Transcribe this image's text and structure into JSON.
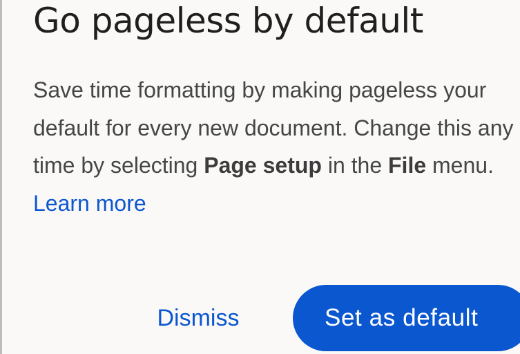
{
  "dialog": {
    "title": "Go pageless by default",
    "body": {
      "text_1": "Save time formatting by making pageless your default for every new document. Change this any time by selecting ",
      "bold_1": "Page setup",
      "text_2": " in the ",
      "bold_2": "File",
      "text_3": " menu. ",
      "link": "Learn more"
    },
    "dismiss_label": "Dismiss",
    "primary_label": "Set as default"
  },
  "colors": {
    "accent": "#0b57d0",
    "background": "#fbf9f7",
    "title_text": "#1f1f1f",
    "body_text": "#444746"
  }
}
